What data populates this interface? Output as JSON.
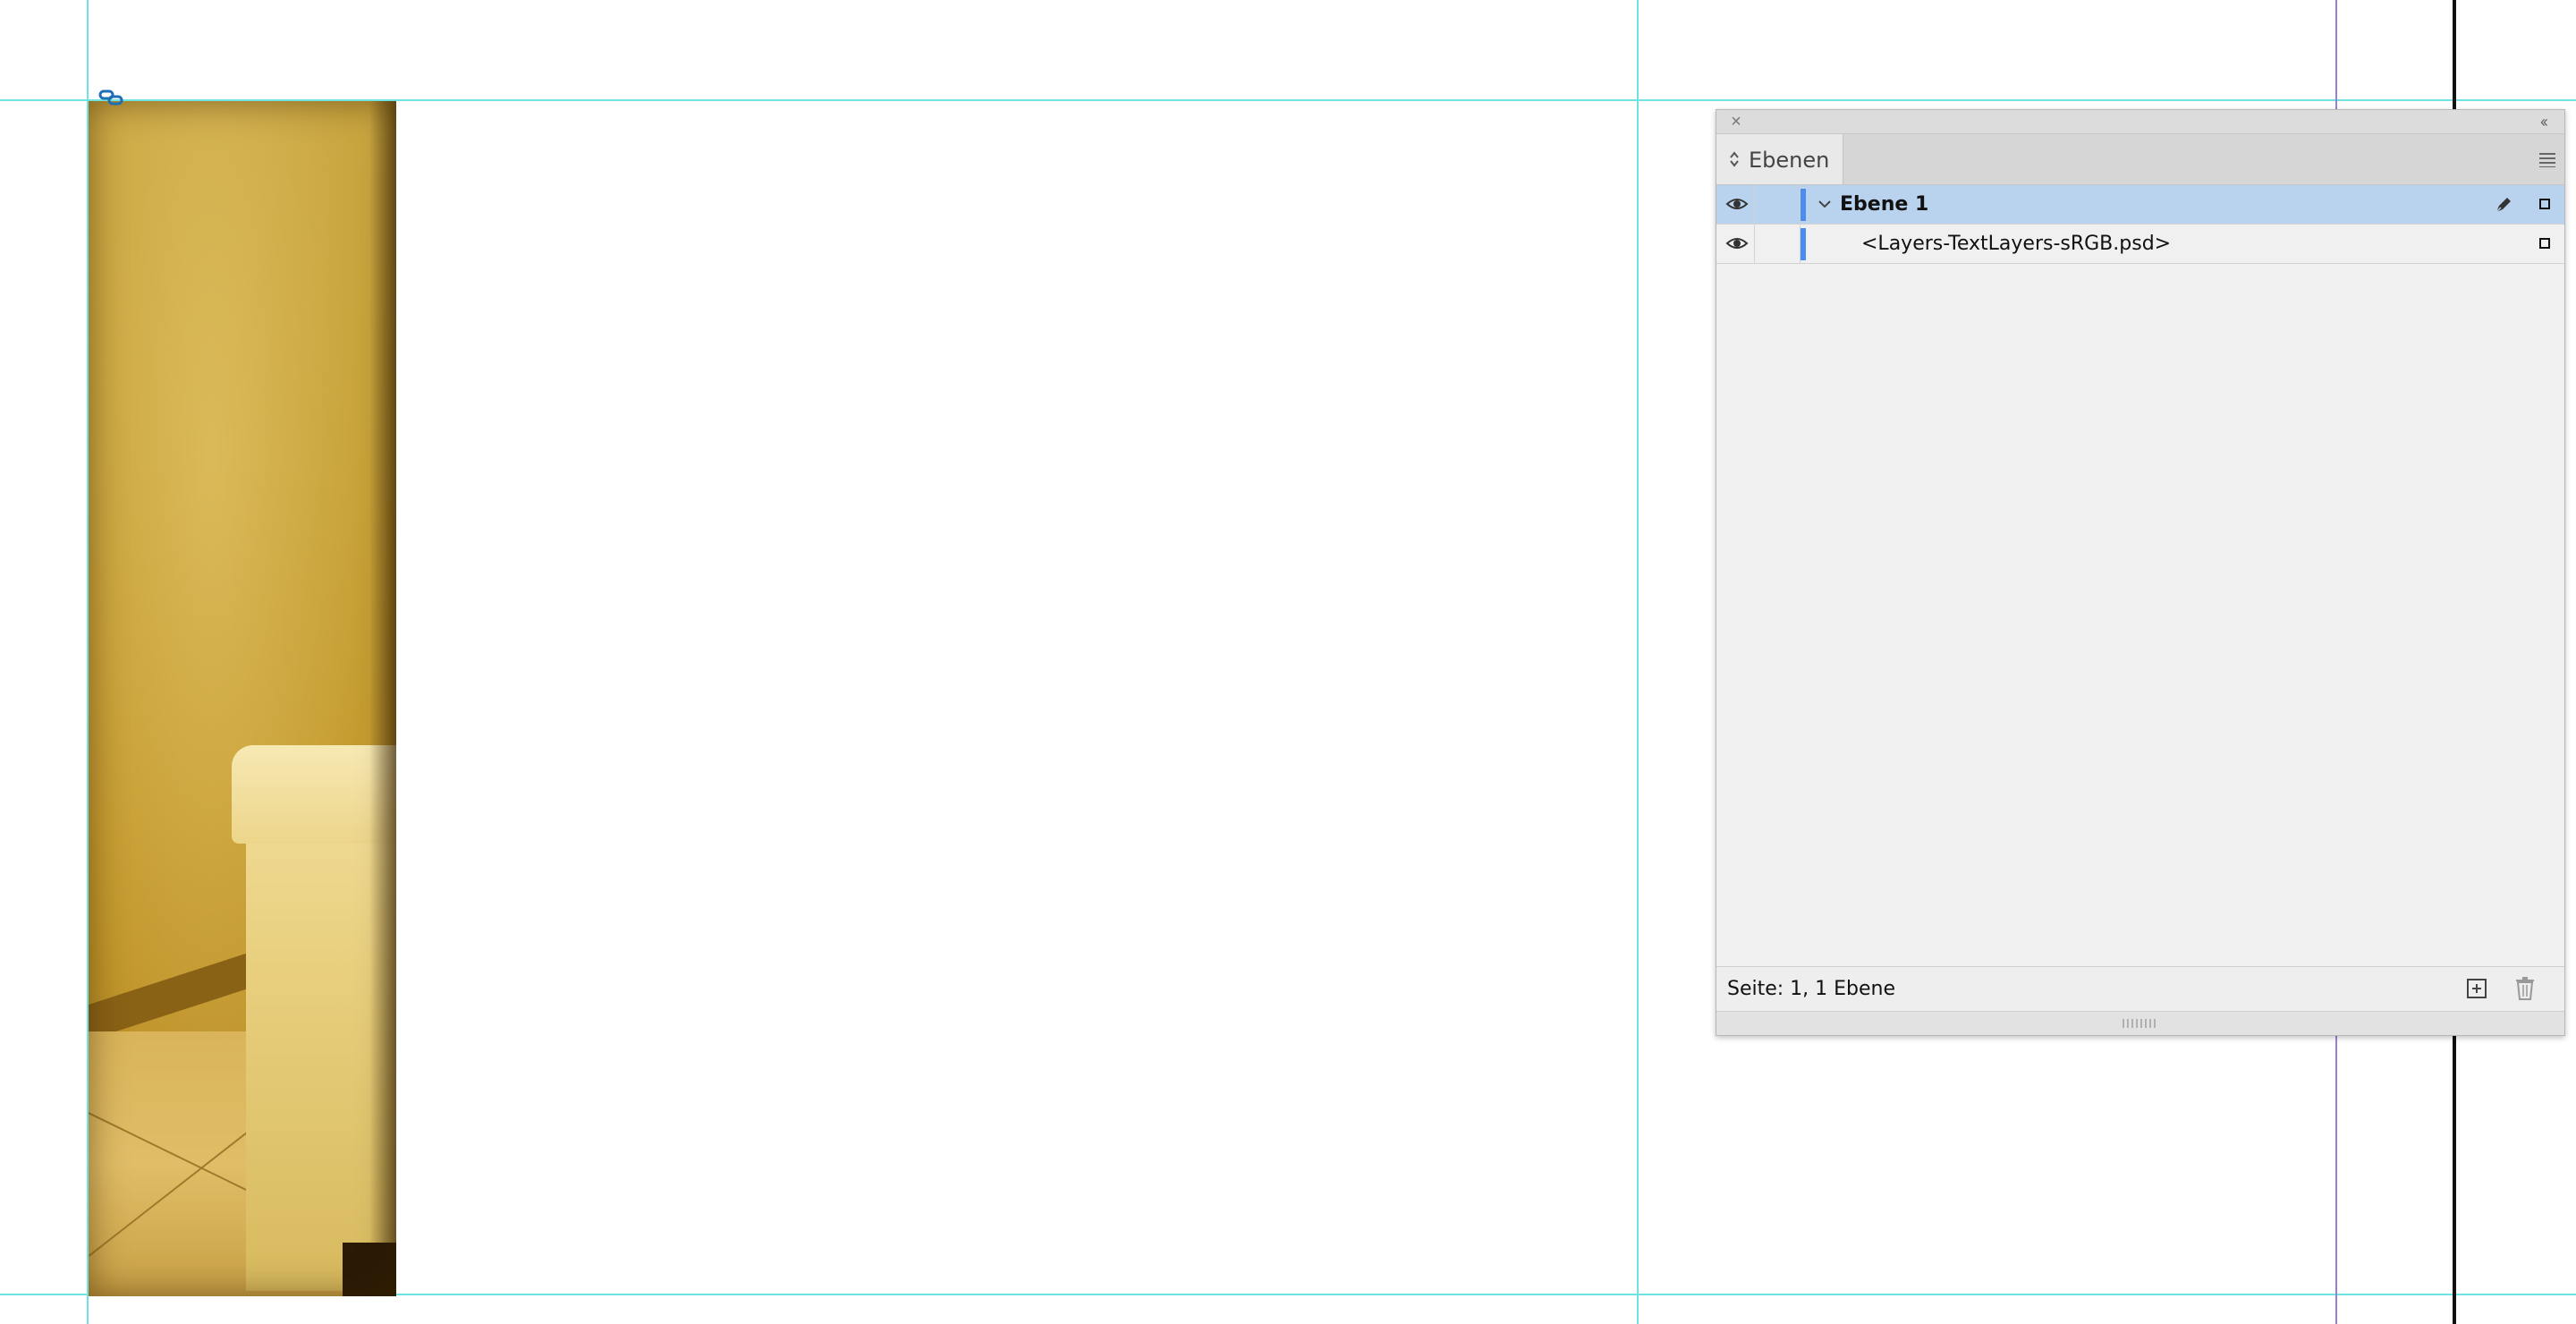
{
  "panel": {
    "tab_label": "Ebenen",
    "layers": [
      {
        "name": "Ebene 1",
        "visible": true,
        "expanded": true,
        "selected": true,
        "color": "#4b8cf0"
      },
      {
        "name": "<Layers-TextLayers-sRGB.psd>",
        "visible": true,
        "selected": false,
        "color": "#4b8cf0"
      }
    ],
    "status": "Seite: 1, 1 Ebene"
  },
  "colors": {
    "guide": "#6fe3e3",
    "selection": "#b9d3ee",
    "layer_color": "#4b8cf0"
  },
  "icons": [
    "close-icon",
    "collapse-icon",
    "tab-arrows-icon",
    "panel-menu-icon",
    "eye-icon",
    "chevron-down-icon",
    "pen-icon",
    "new-layer-icon",
    "trash-icon",
    "link-icon"
  ]
}
